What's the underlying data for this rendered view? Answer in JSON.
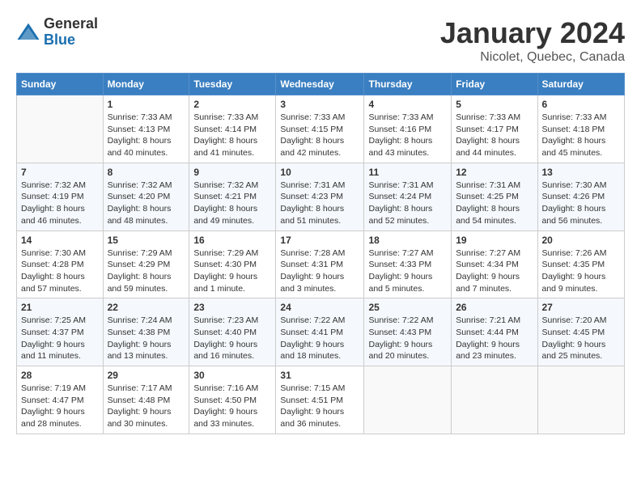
{
  "logo": {
    "general": "General",
    "blue": "Blue"
  },
  "title": "January 2024",
  "subtitle": "Nicolet, Quebec, Canada",
  "headers": [
    "Sunday",
    "Monday",
    "Tuesday",
    "Wednesday",
    "Thursday",
    "Friday",
    "Saturday"
  ],
  "weeks": [
    [
      {
        "day": "",
        "info": ""
      },
      {
        "day": "1",
        "info": "Sunrise: 7:33 AM\nSunset: 4:13 PM\nDaylight: 8 hours\nand 40 minutes."
      },
      {
        "day": "2",
        "info": "Sunrise: 7:33 AM\nSunset: 4:14 PM\nDaylight: 8 hours\nand 41 minutes."
      },
      {
        "day": "3",
        "info": "Sunrise: 7:33 AM\nSunset: 4:15 PM\nDaylight: 8 hours\nand 42 minutes."
      },
      {
        "day": "4",
        "info": "Sunrise: 7:33 AM\nSunset: 4:16 PM\nDaylight: 8 hours\nand 43 minutes."
      },
      {
        "day": "5",
        "info": "Sunrise: 7:33 AM\nSunset: 4:17 PM\nDaylight: 8 hours\nand 44 minutes."
      },
      {
        "day": "6",
        "info": "Sunrise: 7:33 AM\nSunset: 4:18 PM\nDaylight: 8 hours\nand 45 minutes."
      }
    ],
    [
      {
        "day": "7",
        "info": "Sunrise: 7:32 AM\nSunset: 4:19 PM\nDaylight: 8 hours\nand 46 minutes."
      },
      {
        "day": "8",
        "info": "Sunrise: 7:32 AM\nSunset: 4:20 PM\nDaylight: 8 hours\nand 48 minutes."
      },
      {
        "day": "9",
        "info": "Sunrise: 7:32 AM\nSunset: 4:21 PM\nDaylight: 8 hours\nand 49 minutes."
      },
      {
        "day": "10",
        "info": "Sunrise: 7:31 AM\nSunset: 4:23 PM\nDaylight: 8 hours\nand 51 minutes."
      },
      {
        "day": "11",
        "info": "Sunrise: 7:31 AM\nSunset: 4:24 PM\nDaylight: 8 hours\nand 52 minutes."
      },
      {
        "day": "12",
        "info": "Sunrise: 7:31 AM\nSunset: 4:25 PM\nDaylight: 8 hours\nand 54 minutes."
      },
      {
        "day": "13",
        "info": "Sunrise: 7:30 AM\nSunset: 4:26 PM\nDaylight: 8 hours\nand 56 minutes."
      }
    ],
    [
      {
        "day": "14",
        "info": "Sunrise: 7:30 AM\nSunset: 4:28 PM\nDaylight: 8 hours\nand 57 minutes."
      },
      {
        "day": "15",
        "info": "Sunrise: 7:29 AM\nSunset: 4:29 PM\nDaylight: 8 hours\nand 59 minutes."
      },
      {
        "day": "16",
        "info": "Sunrise: 7:29 AM\nSunset: 4:30 PM\nDaylight: 9 hours\nand 1 minute."
      },
      {
        "day": "17",
        "info": "Sunrise: 7:28 AM\nSunset: 4:31 PM\nDaylight: 9 hours\nand 3 minutes."
      },
      {
        "day": "18",
        "info": "Sunrise: 7:27 AM\nSunset: 4:33 PM\nDaylight: 9 hours\nand 5 minutes."
      },
      {
        "day": "19",
        "info": "Sunrise: 7:27 AM\nSunset: 4:34 PM\nDaylight: 9 hours\nand 7 minutes."
      },
      {
        "day": "20",
        "info": "Sunrise: 7:26 AM\nSunset: 4:35 PM\nDaylight: 9 hours\nand 9 minutes."
      }
    ],
    [
      {
        "day": "21",
        "info": "Sunrise: 7:25 AM\nSunset: 4:37 PM\nDaylight: 9 hours\nand 11 minutes."
      },
      {
        "day": "22",
        "info": "Sunrise: 7:24 AM\nSunset: 4:38 PM\nDaylight: 9 hours\nand 13 minutes."
      },
      {
        "day": "23",
        "info": "Sunrise: 7:23 AM\nSunset: 4:40 PM\nDaylight: 9 hours\nand 16 minutes."
      },
      {
        "day": "24",
        "info": "Sunrise: 7:22 AM\nSunset: 4:41 PM\nDaylight: 9 hours\nand 18 minutes."
      },
      {
        "day": "25",
        "info": "Sunrise: 7:22 AM\nSunset: 4:43 PM\nDaylight: 9 hours\nand 20 minutes."
      },
      {
        "day": "26",
        "info": "Sunrise: 7:21 AM\nSunset: 4:44 PM\nDaylight: 9 hours\nand 23 minutes."
      },
      {
        "day": "27",
        "info": "Sunrise: 7:20 AM\nSunset: 4:45 PM\nDaylight: 9 hours\nand 25 minutes."
      }
    ],
    [
      {
        "day": "28",
        "info": "Sunrise: 7:19 AM\nSunset: 4:47 PM\nDaylight: 9 hours\nand 28 minutes."
      },
      {
        "day": "29",
        "info": "Sunrise: 7:17 AM\nSunset: 4:48 PM\nDaylight: 9 hours\nand 30 minutes."
      },
      {
        "day": "30",
        "info": "Sunrise: 7:16 AM\nSunset: 4:50 PM\nDaylight: 9 hours\nand 33 minutes."
      },
      {
        "day": "31",
        "info": "Sunrise: 7:15 AM\nSunset: 4:51 PM\nDaylight: 9 hours\nand 36 minutes."
      },
      {
        "day": "",
        "info": ""
      },
      {
        "day": "",
        "info": ""
      },
      {
        "day": "",
        "info": ""
      }
    ]
  ]
}
